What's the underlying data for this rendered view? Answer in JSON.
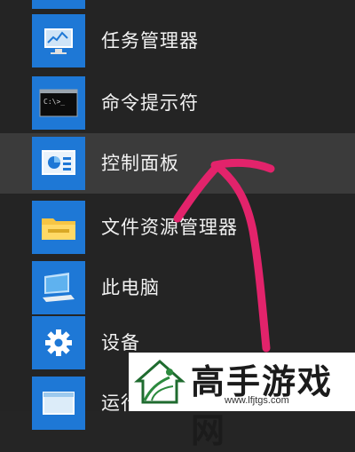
{
  "start_menu": {
    "items": [
      {
        "label": "",
        "icon": "folder-icon"
      },
      {
        "label": "任务管理器",
        "icon": "task-manager-icon"
      },
      {
        "label": "命令提示符",
        "icon": "command-prompt-icon"
      },
      {
        "label": "控制面板",
        "icon": "control-panel-icon"
      },
      {
        "label": "文件资源管理器",
        "icon": "file-explorer-icon"
      },
      {
        "label": "此电脑",
        "icon": "this-pc-icon"
      },
      {
        "label": "设备",
        "icon": "settings-gear-icon"
      },
      {
        "label": "运行",
        "icon": "run-icon"
      }
    ]
  },
  "annotation": {
    "color": "#e2236b"
  },
  "watermark": {
    "title": "高手游戏网",
    "url": "www.lfjtgs.com"
  },
  "colors": {
    "tile": "#1e78d6",
    "hover": "#3b3b3b",
    "background": "#242424"
  }
}
